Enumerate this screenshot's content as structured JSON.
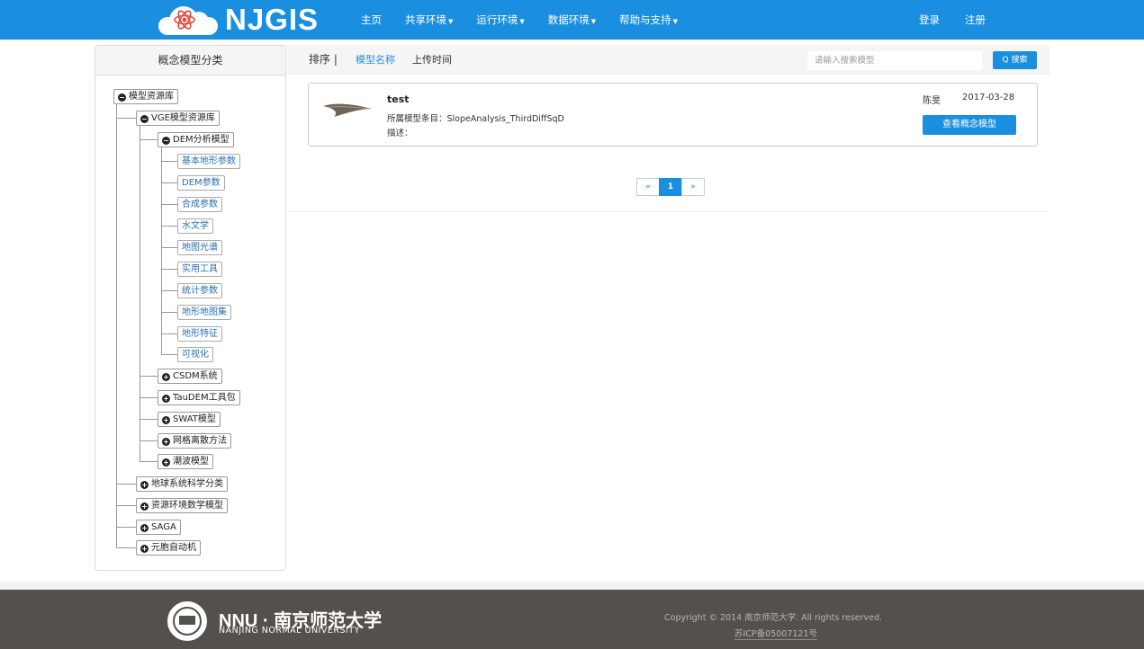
{
  "brand": {
    "name": "NJGIS",
    "accent": "#1a8fe0"
  },
  "nav": {
    "items": [
      {
        "label": "主页",
        "dropdown": false
      },
      {
        "label": "共享环境",
        "dropdown": true
      },
      {
        "label": "运行环境",
        "dropdown": true
      },
      {
        "label": "数据环境",
        "dropdown": true
      },
      {
        "label": "帮助与支持",
        "dropdown": true
      }
    ],
    "login": "登录",
    "register": "注册"
  },
  "sidebar": {
    "title": "概念模型分类",
    "tree": {
      "root": "模型资源库",
      "vge": "VGE模型资源库",
      "dem": "DEM分析模型",
      "dem_children": [
        "基本地形参数",
        "DEM参数",
        "合成参数",
        "水文学",
        "地图光谱",
        "实用工具",
        "统计参数",
        "地形地图集",
        "地形特征",
        "可视化"
      ],
      "vge_children_collapsed": [
        "CSDM系统",
        "TauDEM工具包",
        "SWAT模型",
        "网格离散方法",
        "潮波模型"
      ],
      "root_children_collapsed": [
        "地球系统科学分类",
        "资源环境数学模型",
        "SAGA",
        "元胞自动机"
      ]
    }
  },
  "sortbar": {
    "label": "排序 |",
    "by_name": "模型名称",
    "by_time": "上传时间",
    "search_placeholder": "请输入搜索模型",
    "search_button": "Q 搜索"
  },
  "results": [
    {
      "title": "test",
      "entry": "所属模型条目：SlopeAnalysis_ThirdDiffSqD",
      "desc": "描述：",
      "author": "陈旻",
      "date": "2017-03-28",
      "button": "查看概念模型"
    }
  ],
  "pagination": {
    "prev": "«",
    "current": "1",
    "next": "»"
  },
  "footer": {
    "nnu": "NNU · 南京师范大学",
    "nnu_en": "NANJING NORMAL UNIVERSITY",
    "copyright": "Copyright © 2014 南京师范大学. All rights reserved.",
    "icp": "苏ICP备05007121号"
  }
}
